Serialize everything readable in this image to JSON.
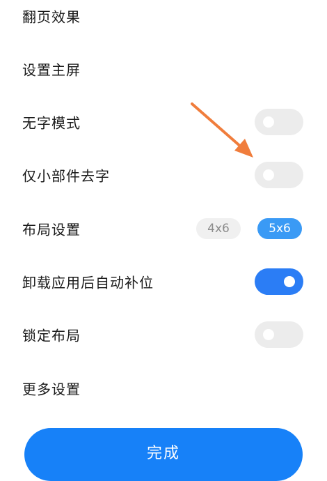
{
  "settings": {
    "items": [
      {
        "label": "翻页效果",
        "control": "none"
      },
      {
        "label": "设置主屏",
        "control": "none"
      },
      {
        "label": "无字模式",
        "control": "toggle",
        "on": false
      },
      {
        "label": "仅小部件去字",
        "control": "toggle",
        "on": false
      },
      {
        "label": "布局设置",
        "control": "chips",
        "options": [
          "4x6",
          "5x6"
        ],
        "selected": "5x6"
      },
      {
        "label": "卸载应用后自动补位",
        "control": "toggle",
        "on": true
      },
      {
        "label": "锁定布局",
        "control": "toggle",
        "on": false
      },
      {
        "label": "更多设置",
        "control": "none"
      }
    ]
  },
  "done_button": {
    "label": "完成"
  },
  "annotation": {
    "type": "arrow",
    "color": "#f07d3c",
    "points_to": "仅小部件去字 toggle"
  },
  "colors": {
    "accent": "#1781f8",
    "toggle_on": "#2b7df5",
    "toggle_off": "#ececec",
    "chip_selected": "#3a9af5",
    "chip_unselected": "#f0f0f0"
  }
}
